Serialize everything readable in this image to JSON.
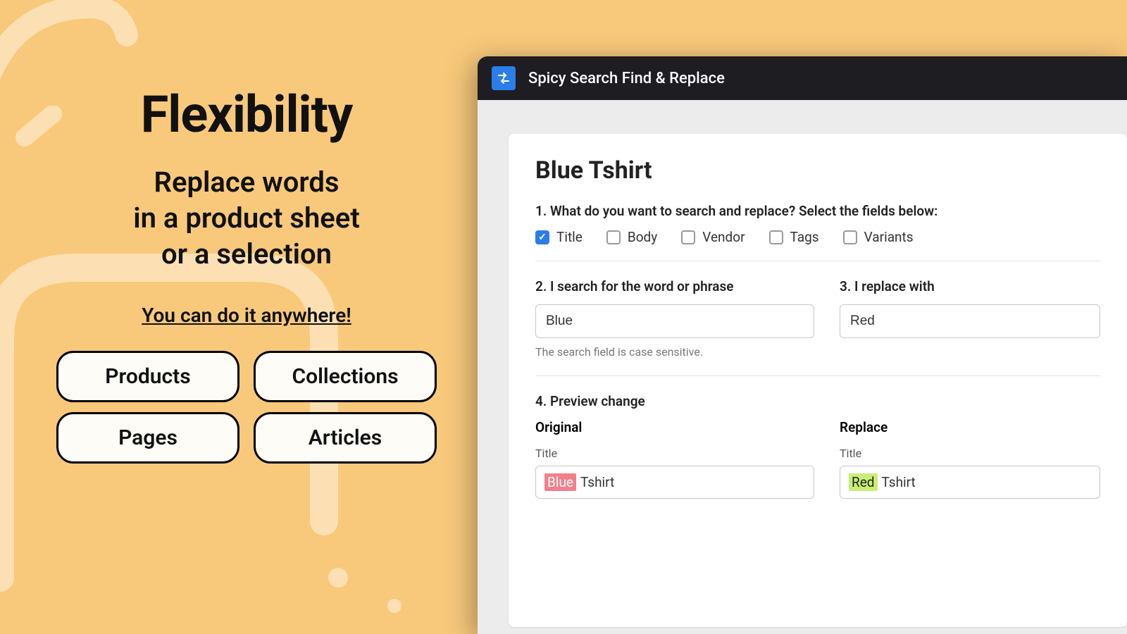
{
  "marketing": {
    "headline": "Flexibility",
    "subtitle_line1": "Replace words",
    "subtitle_line2": "in a product sheet",
    "subtitle_line3": "or a selection",
    "anywhere": "You can do it anywhere!",
    "pills": [
      "Products",
      "Collections",
      "Pages",
      "Articles"
    ]
  },
  "app": {
    "title": "Spicy Search Find & Replace",
    "product_title": "Blue Tshirt",
    "step1_label": "1. What do you want to search and replace? Select the fields below:",
    "fields": [
      {
        "label": "Title",
        "checked": true
      },
      {
        "label": "Body",
        "checked": false
      },
      {
        "label": "Vendor",
        "checked": false
      },
      {
        "label": "Tags",
        "checked": false
      },
      {
        "label": "Variants",
        "checked": false
      }
    ],
    "step2_label": "2. I search for the word or phrase",
    "search_value": "Blue",
    "search_hint": "The search field is case sensitive.",
    "step3_label": "3. I replace with",
    "replace_value": "Red",
    "step4_label": "4. Preview change",
    "preview": {
      "original_head": "Original",
      "replace_head": "Replace",
      "field_label": "Title",
      "original_highlight": "Blue",
      "original_rest": "Tshirt",
      "replace_highlight": "Red",
      "replace_rest": "Tshirt"
    }
  }
}
